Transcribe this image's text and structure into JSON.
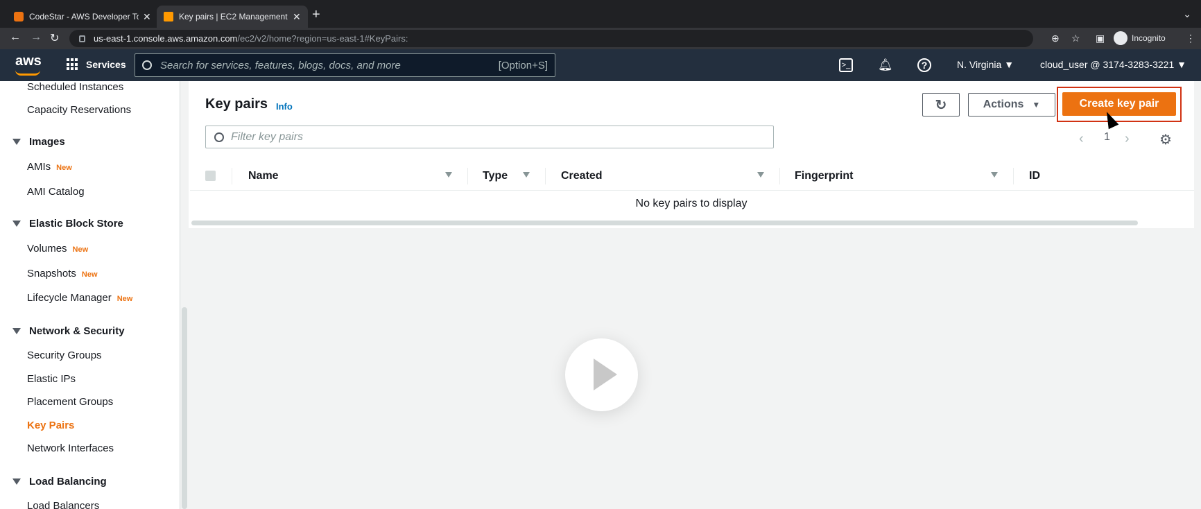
{
  "browser": {
    "tabs": [
      {
        "title": "CodeStar - AWS Developer Too",
        "active": false
      },
      {
        "title": "Key pairs | EC2 Management C",
        "active": true
      }
    ],
    "url_host": "us-east-1.console.aws.amazon.com",
    "url_path": "/ec2/v2/home?region=us-east-1#KeyPairs:",
    "profile_label": "Incognito"
  },
  "aws_header": {
    "logo": "aws",
    "services_label": "Services",
    "search_placeholder": "Search for services, features, blogs, docs, and more",
    "search_shortcut": "[Option+S]",
    "region": "N. Virginia ▼",
    "account": "cloud_user @ 3174-3283-3221 ▼"
  },
  "sidebar": {
    "items": [
      {
        "label": "Scheduled Instances"
      },
      {
        "label": "Capacity Reservations"
      }
    ],
    "images_heading": "Images",
    "images": [
      {
        "label": "AMIs",
        "badge": "New"
      },
      {
        "label": "AMI Catalog"
      }
    ],
    "ebs_heading": "Elastic Block Store",
    "ebs": [
      {
        "label": "Volumes",
        "badge": "New"
      },
      {
        "label": "Snapshots",
        "badge": "New"
      },
      {
        "label": "Lifecycle Manager",
        "badge": "New"
      }
    ],
    "net_heading": "Network & Security",
    "net": [
      {
        "label": "Security Groups"
      },
      {
        "label": "Elastic IPs"
      },
      {
        "label": "Placement Groups"
      },
      {
        "label": "Key Pairs",
        "active": true
      },
      {
        "label": "Network Interfaces"
      }
    ],
    "lb_heading": "Load Balancing",
    "lb": [
      {
        "label": "Load Balancers"
      }
    ]
  },
  "main": {
    "title": "Key pairs",
    "info": "Info",
    "actions_label": "Actions",
    "create_label": "Create key pair",
    "filter_placeholder": "Filter key pairs",
    "page_number": "1",
    "columns": [
      "Name",
      "Type",
      "Created",
      "Fingerprint",
      "ID"
    ],
    "empty_message": "No key pairs to display"
  },
  "colors": {
    "accent": "#ec7211",
    "header_bg": "#232f3e",
    "link": "#0073bb"
  }
}
